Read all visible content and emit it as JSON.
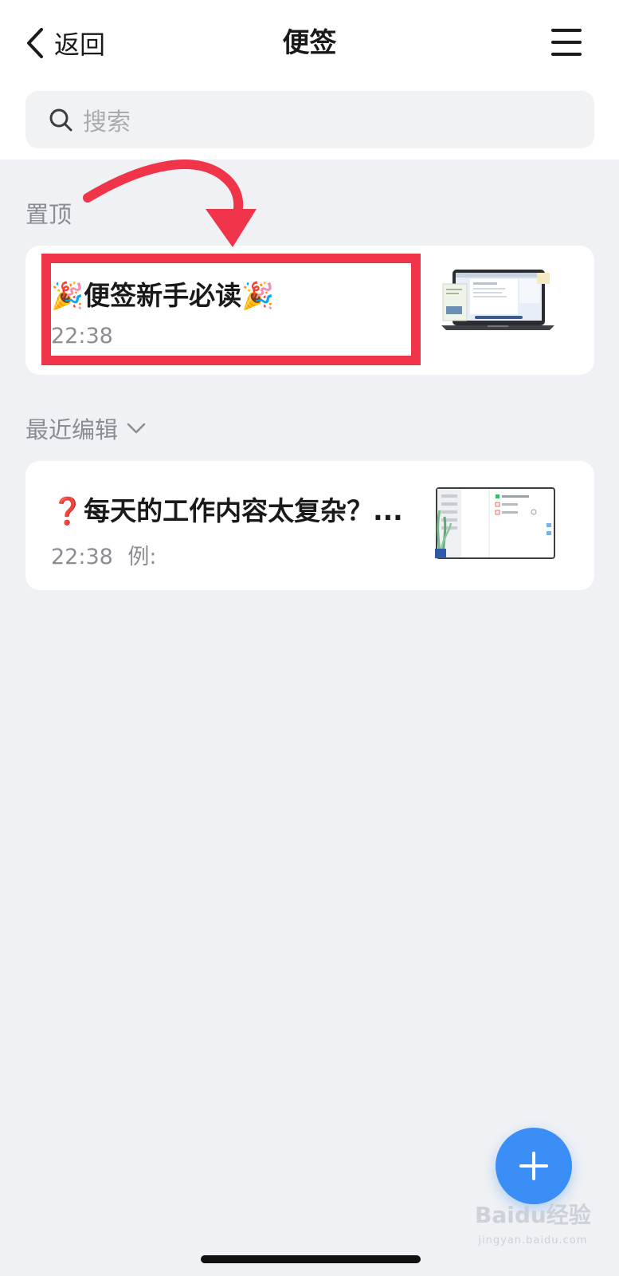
{
  "header": {
    "back_label": "返回",
    "title": "便签"
  },
  "search": {
    "placeholder": "搜索"
  },
  "sections": {
    "pinned_label": "置顶",
    "recent_label": "最近编辑"
  },
  "notes": [
    {
      "title": "🎉便签新手必读🎉",
      "time": "22:38",
      "preview": "",
      "thumbnail": "laptop-screenshot"
    },
    {
      "title": "❓每天的工作内容太复杂？...",
      "time": "22:38",
      "preview": "例:",
      "thumbnail": "checklist-screenshot"
    }
  ],
  "annotation": {
    "highlight_color": "#f0354a",
    "arrow_color": "#f0354a"
  },
  "fab": {
    "icon": "plus-icon",
    "color": "#3a8ef6"
  },
  "watermark": {
    "text": "Baidu经验",
    "subtext": "jingyan.baidu.com"
  }
}
